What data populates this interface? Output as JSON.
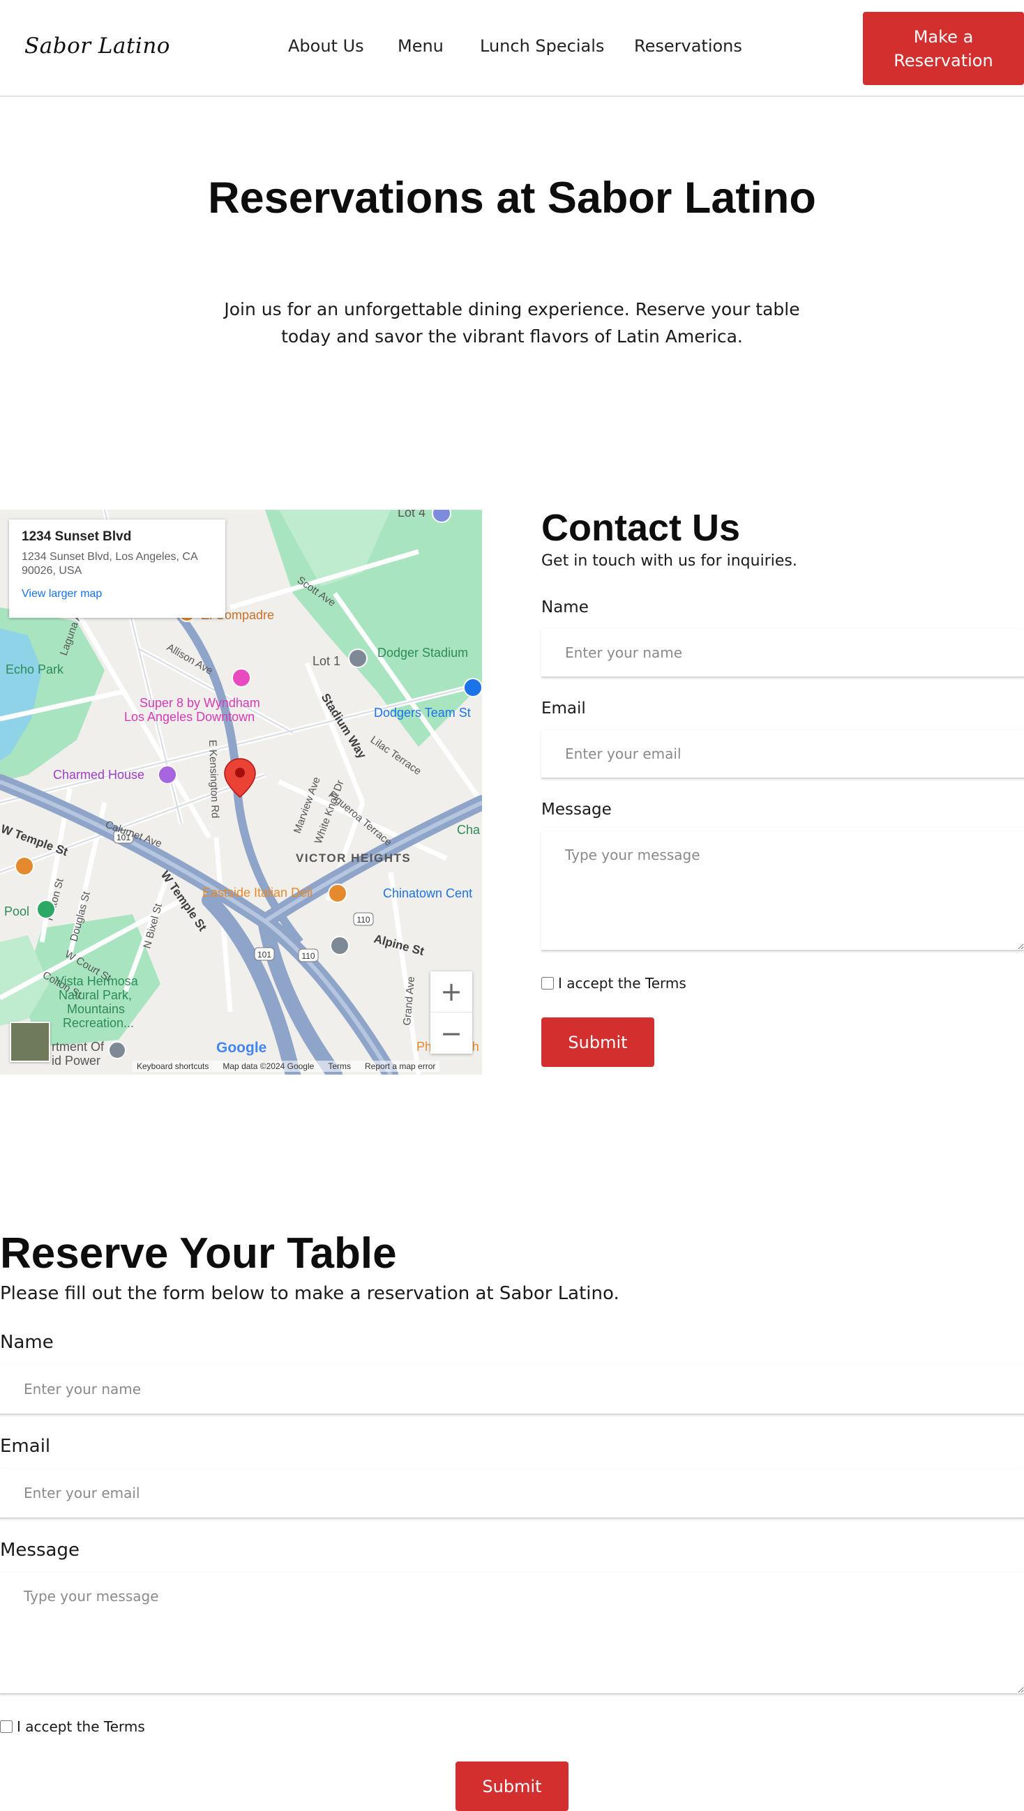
{
  "header": {
    "logo": "Sabor Latino",
    "nav": [
      "About Us",
      "Menu",
      "Lunch Specials",
      "Reservations"
    ],
    "cta": "Make a Reservation"
  },
  "hero": {
    "title": "Reservations at Sabor Latino",
    "subtitle": "Join us for an unforgettable dining experience. Reserve your table today and savor the vibrant flavors of Latin America."
  },
  "map": {
    "card_title": "1234 Sunset Blvd",
    "card_address": "1234 Sunset Blvd, Los Angeles, CA 90026, USA",
    "card_link": "View larger map",
    "places": {
      "echo_park": "Echo Park",
      "dodger_stadium": "Dodger Stadium",
      "dodgers_store": "Dodgers Team St",
      "super8": "Super 8 by Wyndham",
      "super8b": "Los Angeles Downtown",
      "charmed_house": "Charmed House",
      "el_compadre": "El Compadre",
      "lot1": "Lot 1",
      "lot4": "Lot 4",
      "victor_heights": "VICTOR HEIGHTS",
      "eastside_deli": "Eastside Italian Deli",
      "chinatown": "Chinatown Cent",
      "vista_hermosa": "Vista Hermosa",
      "vista_hermosa2": "Natural Park,",
      "vista_hermosa3": "Mountains",
      "vista_hermosa4": "Recreation...",
      "pool": "Pool",
      "dept": "rtment Of",
      "dept2": "id Power",
      "philippe": "Philippe Th",
      "cha": "Cha"
    },
    "streets": {
      "w_temple": "W Temple St",
      "w_temple2": "W Temple St",
      "alpine": "Alpine St",
      "stadium_way": "Stadium Way",
      "scott": "Scott Ave",
      "allison": "Allison Ave",
      "calumet": "Calumet Ave",
      "kensington": "E Kensington Rd",
      "marview": "Marview Ave",
      "white_knoll": "White Knoll Dr",
      "figueroa": "Figueroa Terrace",
      "lilac": "Lilac Terrace",
      "laguna": "Laguna Ave",
      "patton": "Patton St",
      "douglas": "Douglas St",
      "n_bixel": "N Bixel St",
      "w_court": "W Court St",
      "colton": "Colton St",
      "grand": "Grand Ave",
      "hwy101a": "101",
      "hwy101b": "101",
      "hwy110a": "110",
      "hwy110b": "110"
    },
    "zoom_in": "+",
    "zoom_out": "−",
    "google": "Google",
    "footer": [
      "Keyboard shortcuts",
      "Map data ©2024 Google",
      "Terms",
      "Report a map error"
    ]
  },
  "contact": {
    "title": "Contact Us",
    "subtitle": "Get in touch with us for inquiries.",
    "name_label": "Name",
    "name_placeholder": "Enter your name",
    "email_label": "Email",
    "email_placeholder": "Enter your email",
    "message_label": "Message",
    "message_placeholder": "Type your message",
    "terms": "I accept the Terms",
    "submit": "Submit"
  },
  "reserve": {
    "title": "Reserve Your Table",
    "subtitle": "Please fill out the form below to make a reservation at Sabor Latino.",
    "name_label": "Name",
    "name_placeholder": "Enter your name",
    "email_label": "Email",
    "email_placeholder": "Enter your email",
    "message_label": "Message",
    "message_placeholder": "Type your message",
    "terms": "I accept the Terms",
    "submit": "Submit"
  },
  "colors": {
    "accent": "#d32f2f",
    "text": "#111111",
    "park": "#a8e4bf",
    "water": "#8fd3e8",
    "freeway": "#8ea4c8"
  }
}
